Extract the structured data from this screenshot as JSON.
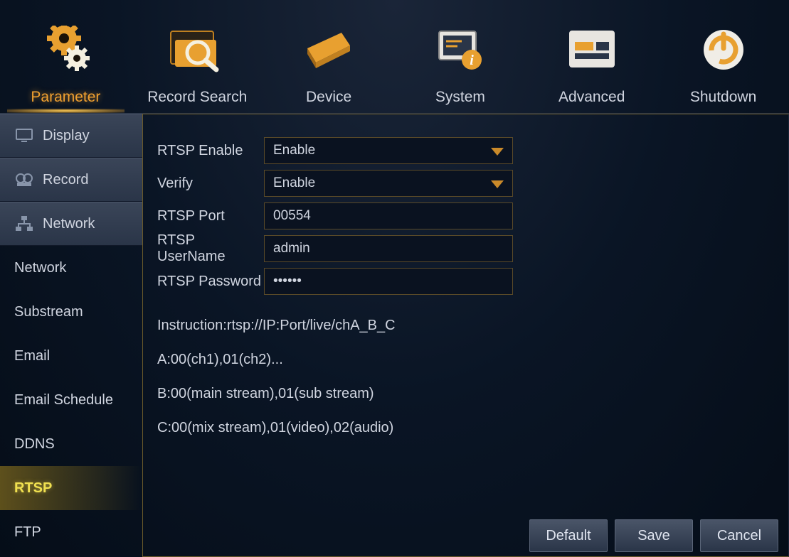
{
  "topTabs": {
    "parameter": "Parameter",
    "recordSearch": "Record Search",
    "device": "Device",
    "system": "System",
    "advanced": "Advanced",
    "shutdown": "Shutdown"
  },
  "sidebar": {
    "display": "Display",
    "record": "Record",
    "network": "Network",
    "sub_network": "Network",
    "substream": "Substream",
    "email": "Email",
    "emailSchedule": "Email Schedule",
    "ddns": "DDNS",
    "rtsp": "RTSP",
    "ftp": "FTP"
  },
  "form": {
    "rtspEnable": {
      "label": "RTSP Enable",
      "value": "Enable"
    },
    "verify": {
      "label": "Verify",
      "value": "Enable"
    },
    "rtspPort": {
      "label": "RTSP Port",
      "value": "00554"
    },
    "rtspUser": {
      "label": "RTSP UserName",
      "value": "admin"
    },
    "rtspPass": {
      "label": "RTSP Password",
      "value": "••••••"
    }
  },
  "info": {
    "l1": "Instruction:rtsp://IP:Port/live/chA_B_C",
    "l2": "A:00(ch1),01(ch2)...",
    "l3": "B:00(main stream),01(sub stream)",
    "l4": "C:00(mix stream),01(video),02(audio)"
  },
  "buttons": {
    "default": "Default",
    "save": "Save",
    "cancel": "Cancel"
  }
}
